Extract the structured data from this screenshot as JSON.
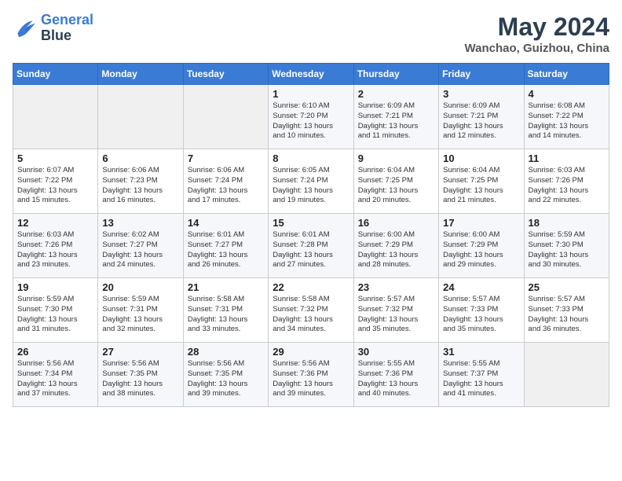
{
  "header": {
    "logo_line1": "General",
    "logo_line2": "Blue",
    "month_year": "May 2024",
    "location": "Wanchao, Guizhou, China"
  },
  "weekdays": [
    "Sunday",
    "Monday",
    "Tuesday",
    "Wednesday",
    "Thursday",
    "Friday",
    "Saturday"
  ],
  "weeks": [
    [
      {
        "day": "",
        "info": ""
      },
      {
        "day": "",
        "info": ""
      },
      {
        "day": "",
        "info": ""
      },
      {
        "day": "1",
        "info": "Sunrise: 6:10 AM\nSunset: 7:20 PM\nDaylight: 13 hours\nand 10 minutes."
      },
      {
        "day": "2",
        "info": "Sunrise: 6:09 AM\nSunset: 7:21 PM\nDaylight: 13 hours\nand 11 minutes."
      },
      {
        "day": "3",
        "info": "Sunrise: 6:09 AM\nSunset: 7:21 PM\nDaylight: 13 hours\nand 12 minutes."
      },
      {
        "day": "4",
        "info": "Sunrise: 6:08 AM\nSunset: 7:22 PM\nDaylight: 13 hours\nand 14 minutes."
      }
    ],
    [
      {
        "day": "5",
        "info": "Sunrise: 6:07 AM\nSunset: 7:22 PM\nDaylight: 13 hours\nand 15 minutes."
      },
      {
        "day": "6",
        "info": "Sunrise: 6:06 AM\nSunset: 7:23 PM\nDaylight: 13 hours\nand 16 minutes."
      },
      {
        "day": "7",
        "info": "Sunrise: 6:06 AM\nSunset: 7:24 PM\nDaylight: 13 hours\nand 17 minutes."
      },
      {
        "day": "8",
        "info": "Sunrise: 6:05 AM\nSunset: 7:24 PM\nDaylight: 13 hours\nand 19 minutes."
      },
      {
        "day": "9",
        "info": "Sunrise: 6:04 AM\nSunset: 7:25 PM\nDaylight: 13 hours\nand 20 minutes."
      },
      {
        "day": "10",
        "info": "Sunrise: 6:04 AM\nSunset: 7:25 PM\nDaylight: 13 hours\nand 21 minutes."
      },
      {
        "day": "11",
        "info": "Sunrise: 6:03 AM\nSunset: 7:26 PM\nDaylight: 13 hours\nand 22 minutes."
      }
    ],
    [
      {
        "day": "12",
        "info": "Sunrise: 6:03 AM\nSunset: 7:26 PM\nDaylight: 13 hours\nand 23 minutes."
      },
      {
        "day": "13",
        "info": "Sunrise: 6:02 AM\nSunset: 7:27 PM\nDaylight: 13 hours\nand 24 minutes."
      },
      {
        "day": "14",
        "info": "Sunrise: 6:01 AM\nSunset: 7:27 PM\nDaylight: 13 hours\nand 26 minutes."
      },
      {
        "day": "15",
        "info": "Sunrise: 6:01 AM\nSunset: 7:28 PM\nDaylight: 13 hours\nand 27 minutes."
      },
      {
        "day": "16",
        "info": "Sunrise: 6:00 AM\nSunset: 7:29 PM\nDaylight: 13 hours\nand 28 minutes."
      },
      {
        "day": "17",
        "info": "Sunrise: 6:00 AM\nSunset: 7:29 PM\nDaylight: 13 hours\nand 29 minutes."
      },
      {
        "day": "18",
        "info": "Sunrise: 5:59 AM\nSunset: 7:30 PM\nDaylight: 13 hours\nand 30 minutes."
      }
    ],
    [
      {
        "day": "19",
        "info": "Sunrise: 5:59 AM\nSunset: 7:30 PM\nDaylight: 13 hours\nand 31 minutes."
      },
      {
        "day": "20",
        "info": "Sunrise: 5:59 AM\nSunset: 7:31 PM\nDaylight: 13 hours\nand 32 minutes."
      },
      {
        "day": "21",
        "info": "Sunrise: 5:58 AM\nSunset: 7:31 PM\nDaylight: 13 hours\nand 33 minutes."
      },
      {
        "day": "22",
        "info": "Sunrise: 5:58 AM\nSunset: 7:32 PM\nDaylight: 13 hours\nand 34 minutes."
      },
      {
        "day": "23",
        "info": "Sunrise: 5:57 AM\nSunset: 7:32 PM\nDaylight: 13 hours\nand 35 minutes."
      },
      {
        "day": "24",
        "info": "Sunrise: 5:57 AM\nSunset: 7:33 PM\nDaylight: 13 hours\nand 35 minutes."
      },
      {
        "day": "25",
        "info": "Sunrise: 5:57 AM\nSunset: 7:33 PM\nDaylight: 13 hours\nand 36 minutes."
      }
    ],
    [
      {
        "day": "26",
        "info": "Sunrise: 5:56 AM\nSunset: 7:34 PM\nDaylight: 13 hours\nand 37 minutes."
      },
      {
        "day": "27",
        "info": "Sunrise: 5:56 AM\nSunset: 7:35 PM\nDaylight: 13 hours\nand 38 minutes."
      },
      {
        "day": "28",
        "info": "Sunrise: 5:56 AM\nSunset: 7:35 PM\nDaylight: 13 hours\nand 39 minutes."
      },
      {
        "day": "29",
        "info": "Sunrise: 5:56 AM\nSunset: 7:36 PM\nDaylight: 13 hours\nand 39 minutes."
      },
      {
        "day": "30",
        "info": "Sunrise: 5:55 AM\nSunset: 7:36 PM\nDaylight: 13 hours\nand 40 minutes."
      },
      {
        "day": "31",
        "info": "Sunrise: 5:55 AM\nSunset: 7:37 PM\nDaylight: 13 hours\nand 41 minutes."
      },
      {
        "day": "",
        "info": ""
      }
    ]
  ]
}
